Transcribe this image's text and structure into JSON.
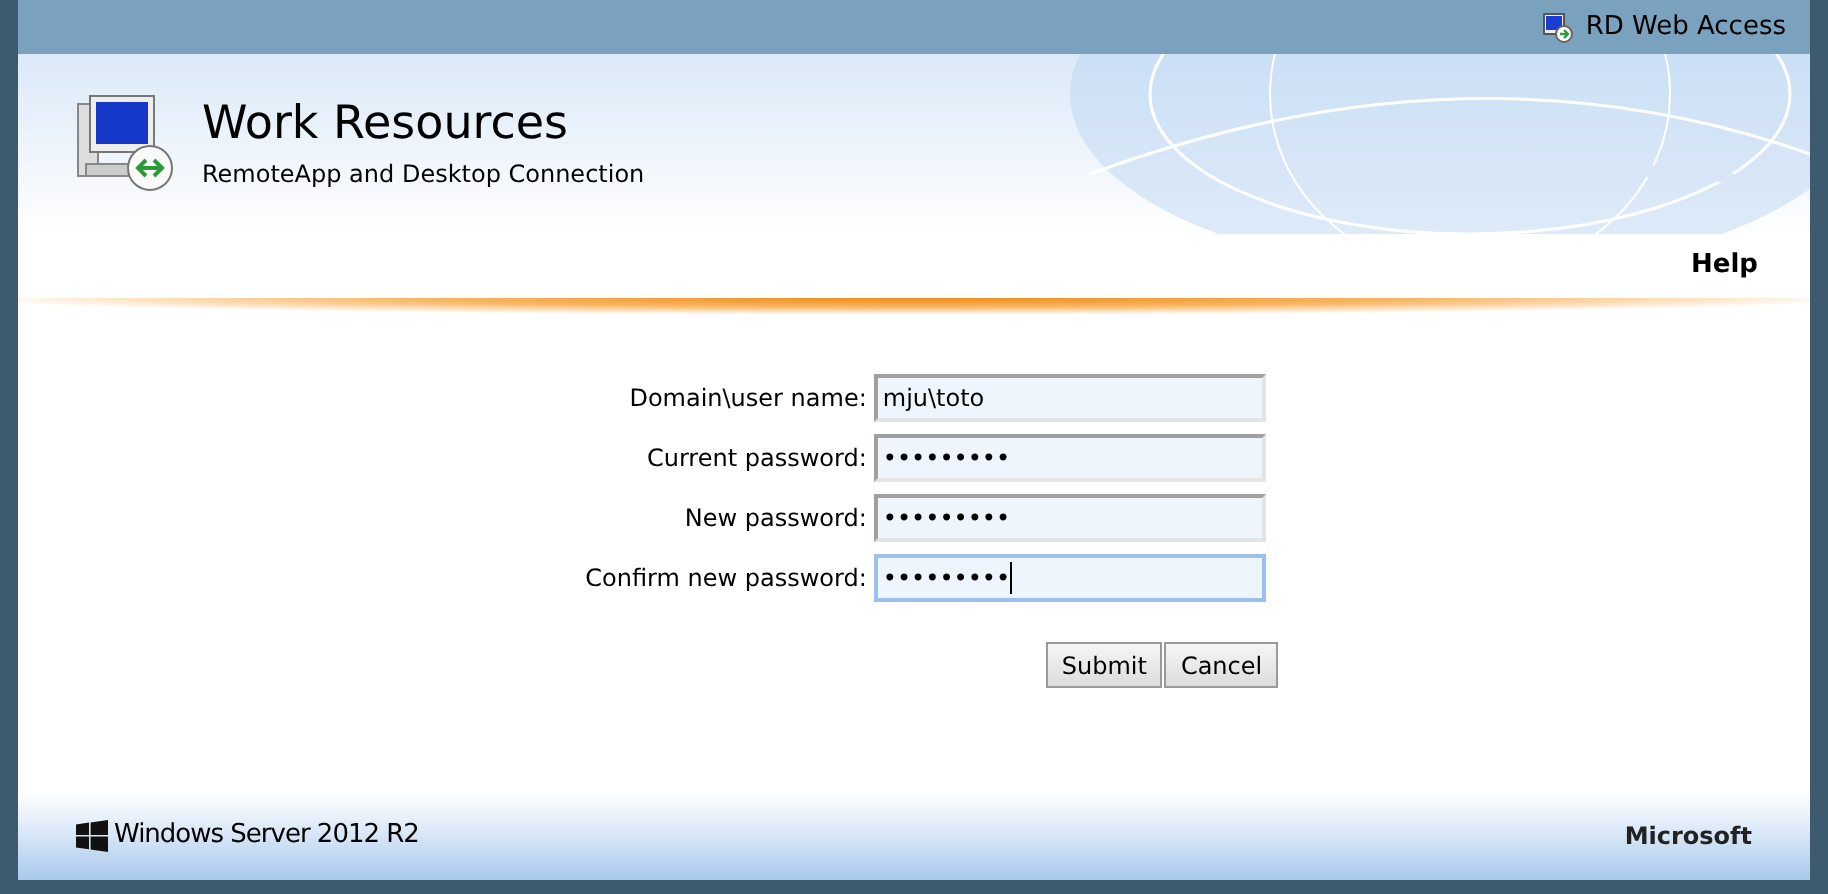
{
  "top_bar": {
    "title": "RD Web Access"
  },
  "header": {
    "title": "Work Resources",
    "subtitle": "RemoteApp and Desktop Connection"
  },
  "nav": {
    "help": "Help"
  },
  "form": {
    "fields": [
      {
        "label": "Domain\\user name:",
        "value": "mju\\toto",
        "focused": false
      },
      {
        "label": "Current password:",
        "value": "•••••••••",
        "focused": false
      },
      {
        "label": "New password:",
        "value": "•••••••••",
        "focused": false
      },
      {
        "label": "Confirm new password:",
        "value": "•••••••••",
        "focused": true
      }
    ],
    "buttons": [
      "Submit",
      "Cancel"
    ]
  },
  "footer": {
    "product": "Windows Server 2012 R2",
    "vendor": "Microsoft"
  }
}
